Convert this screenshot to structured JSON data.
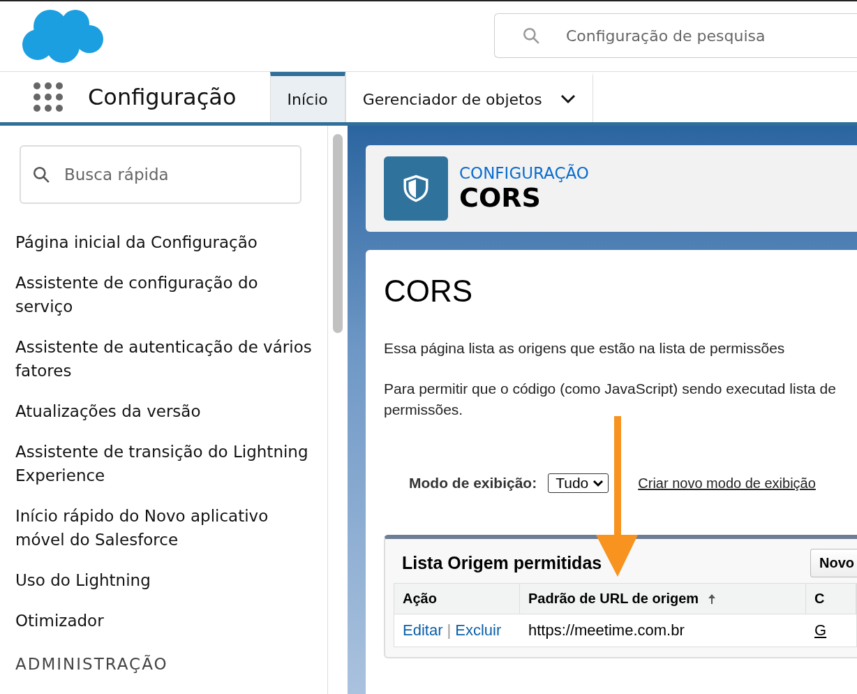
{
  "header": {
    "search": {
      "placeholder": "Configuração de pesquisa"
    }
  },
  "nav": {
    "app_name": "Configuração",
    "tabs": [
      {
        "label": "Início",
        "selected": true,
        "dropdown": false
      },
      {
        "label": "Gerenciador de objetos",
        "selected": false,
        "dropdown": true
      }
    ]
  },
  "sidebar": {
    "search": {
      "placeholder": "Busca rápida"
    },
    "items": [
      "Página inicial da Configuração",
      "Assistente de configuração do serviço",
      "Assistente de autenticação de vários fatores",
      "Atualizações da versão",
      "Assistente de transição do Lightning Experience",
      "Início rápido do Novo aplicativo móvel do Salesforce",
      "Uso do Lightning",
      "Otimizador"
    ],
    "section_heading": "ADMINISTRAÇÃO"
  },
  "page_header": {
    "eyebrow": "CONFIGURAÇÃO",
    "title": "CORS"
  },
  "content": {
    "title": "CORS",
    "paragraphs": [
      "Essa página lista as origens que estão na lista de permissões",
      "Para permitir que o código (como JavaScript) sendo executad lista de permissões."
    ],
    "view": {
      "label": "Modo de exibição:",
      "value": "Tudo",
      "link": "Criar novo modo de exibição"
    },
    "list": {
      "title": "Lista Origem permitidas",
      "button": "Novo",
      "columns": [
        {
          "label": "Ação",
          "sorted": false
        },
        {
          "label": "Padrão de URL de origem",
          "sorted": true
        },
        {
          "label": "C",
          "sorted": false
        }
      ],
      "rows": [
        {
          "actions": [
            "Editar",
            "Excluir"
          ],
          "separator": "|",
          "url": "https://meetime.com.br",
          "column_3": "G"
        }
      ]
    }
  }
}
